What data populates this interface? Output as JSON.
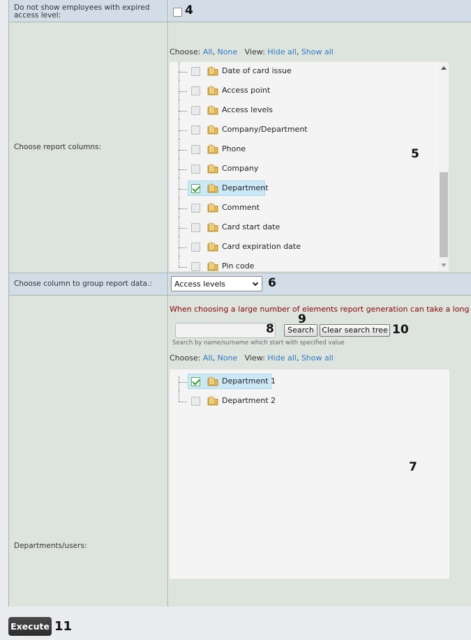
{
  "expired": {
    "label": "Do not show employees with expired access level:",
    "checked": false,
    "annotation": "4"
  },
  "columns": {
    "label": "Choose report columns:",
    "choose_label": "Choose:",
    "all": "All",
    "none": "None",
    "view_label": "View:",
    "hide_all": "Hide all",
    "show_all": "Show all",
    "items": [
      {
        "label": "Date of card issue",
        "checked": false
      },
      {
        "label": "Access point",
        "checked": false
      },
      {
        "label": "Access levels",
        "checked": false
      },
      {
        "label": "Company/Department",
        "checked": false
      },
      {
        "label": "Phone",
        "checked": false
      },
      {
        "label": "Company",
        "checked": false
      },
      {
        "label": "Department",
        "checked": true
      },
      {
        "label": "Comment",
        "checked": false
      },
      {
        "label": "Card start date",
        "checked": false
      },
      {
        "label": "Card expiration date",
        "checked": false
      },
      {
        "label": "Pin code",
        "checked": false
      }
    ],
    "annotation": "5"
  },
  "group": {
    "label": "Choose column to group report data.:",
    "selected": "Access levels",
    "annotation": "6"
  },
  "departments": {
    "label": "Departments/users:",
    "warning": "When choosing a large number of elements report generation can take a long time.",
    "search_value": "",
    "search_button": "Search",
    "clear_button": "Clear search tree",
    "hint": "Search by name/surname which start with specified value",
    "choose_label": "Choose:",
    "all": "All",
    "none": "None",
    "view_label": "View:",
    "hide_all": "Hide all",
    "show_all": "Show all",
    "items": [
      {
        "label": "Department 1",
        "checked": true
      },
      {
        "label": "Department 2",
        "checked": false
      }
    ],
    "annotations": {
      "input": "8",
      "search": "9",
      "clear": "10",
      "tree": "7"
    }
  },
  "execute": {
    "label": "Execute",
    "annotation": "11"
  }
}
